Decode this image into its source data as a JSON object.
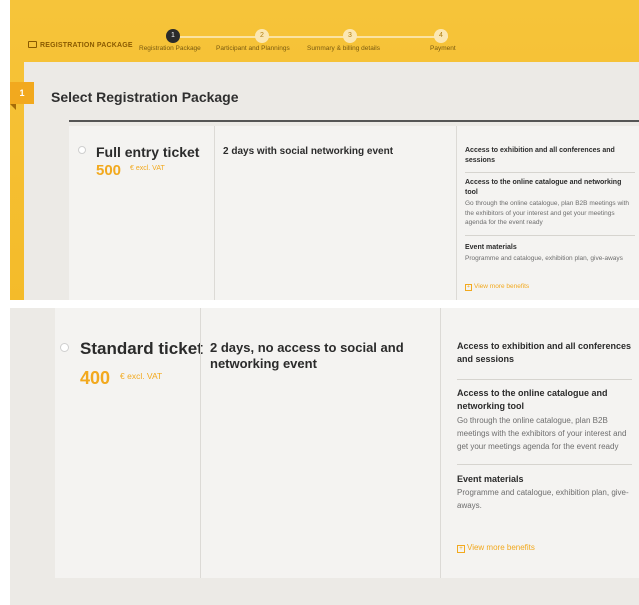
{
  "header": {
    "registration_label": "REGISTRATION PACKAGE",
    "steps": [
      {
        "number": "1",
        "label": "Registration Package",
        "state": "active"
      },
      {
        "number": "2",
        "label": "Participant and Plannings",
        "state": "todo"
      },
      {
        "number": "3",
        "label": "Summary & billing details",
        "state": "todo"
      },
      {
        "number": "4",
        "label": "Payment",
        "state": "todo"
      }
    ]
  },
  "section": {
    "step_number": "1",
    "title": "Select Registration Package"
  },
  "tickets": [
    {
      "name": "Full entry ticket",
      "price": "500",
      "price_note": "€ excl. VAT",
      "description": "2 days with social networking event",
      "benefits": [
        {
          "title": "Access to exhibition and all conferences and sessions",
          "text": ""
        },
        {
          "title": "Access to the online catalogue and networking tool",
          "text": "Go through the online catalogue, plan B2B meetings with the exhibitors of your interest and get your meetings agenda for the event ready"
        },
        {
          "title": "Event materials",
          "text": "Programme and catalogue, exhibition plan, give-aways"
        }
      ],
      "more_link": "View more benefits"
    },
    {
      "name": "Standard ticket",
      "price": "400",
      "price_note": "€ excl. VAT",
      "description": "2 days, no access to social and networking event",
      "benefits": [
        {
          "title": "Access to exhibition and all conferences and sessions",
          "text": ""
        },
        {
          "title": "Access to the online catalogue and networking tool",
          "text": "Go through the online catalogue, plan B2B meetings with the exhibitors of your interest and get your meetings agenda for the event ready"
        },
        {
          "title": "Event materials",
          "text": "Programme and catalogue, exhibition plan, give-aways."
        }
      ],
      "more_link": "View more benefits"
    }
  ],
  "colors": {
    "accent": "#f2a91e",
    "header_bg": "#f5c12f",
    "panel_bg": "#eceae6",
    "card_bg": "#f4f3f1"
  }
}
